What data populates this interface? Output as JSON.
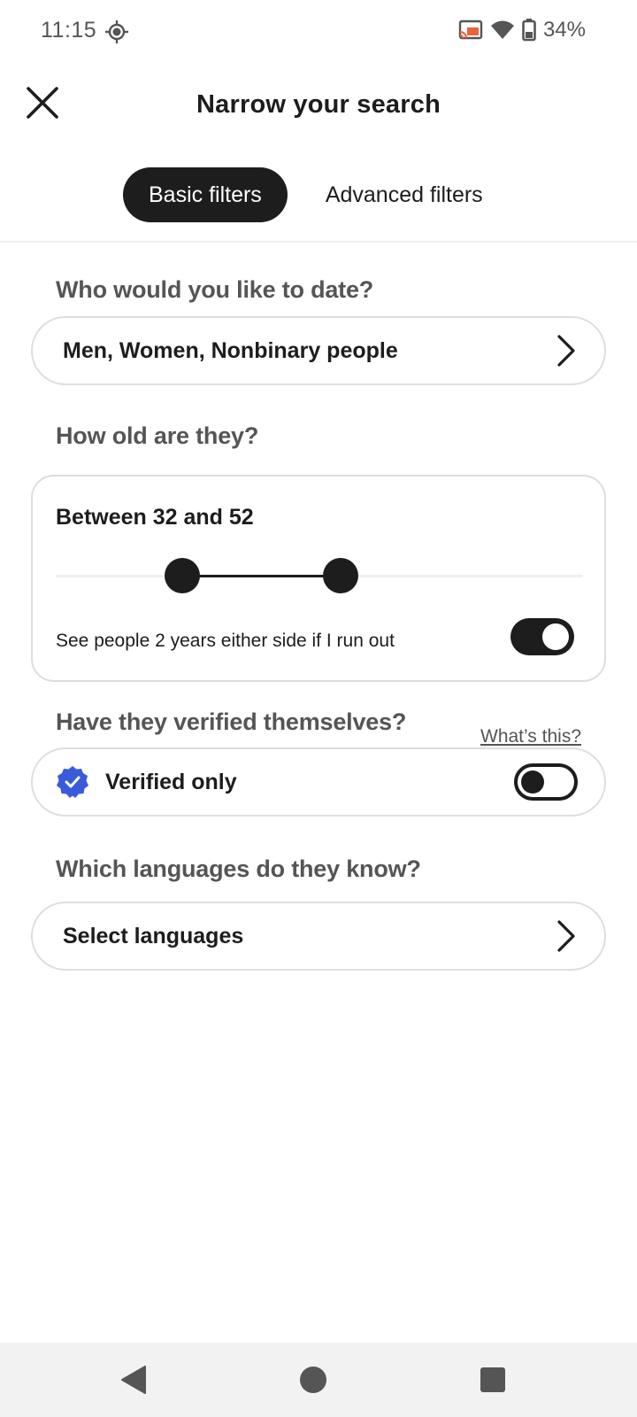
{
  "status_bar": {
    "time": "11:15",
    "battery": "34%",
    "icons": [
      "location-icon",
      "cast-icon",
      "wifi-icon",
      "battery-icon"
    ]
  },
  "header": {
    "title": "Narrow your search",
    "close_icon": "close-icon"
  },
  "tabs": [
    {
      "label": "Basic filters",
      "active": true
    },
    {
      "label": "Advanced filters",
      "active": false
    }
  ],
  "gender": {
    "label": "Who would you like to date?",
    "value": "Men, Women, Nonbinary people"
  },
  "age": {
    "label": "How old are they?",
    "range_text": "Between 32 and 52",
    "min_age": 32,
    "max_age": 52,
    "slider_min_fraction": 0.24,
    "slider_max_fraction": 0.54,
    "extend_text": "See people 2 years either side if I run out",
    "extend_enabled": true
  },
  "verification": {
    "label": "Have they verified themselves?",
    "help_link": "What’s this?",
    "option_label": "Verified only",
    "enabled": false,
    "badge_color": "#3a5bd9"
  },
  "languages": {
    "label": "Which languages do they know?",
    "value": "Select languages"
  },
  "nav_bar": {
    "buttons": [
      "back-icon",
      "home-icon",
      "recents-icon"
    ]
  }
}
